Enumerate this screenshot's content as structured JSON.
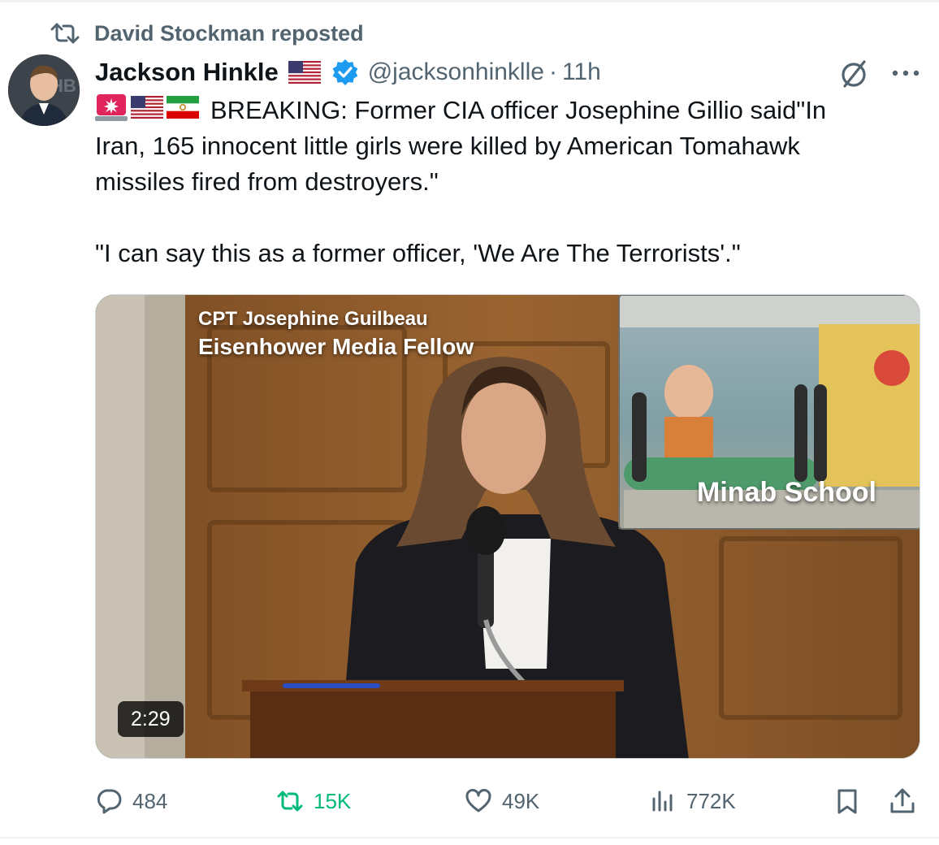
{
  "repost": {
    "text": "David Stockman reposted",
    "icon": "repost-icon"
  },
  "author": {
    "name": "Jackson Hinkle",
    "handle": "@jacksonhinklle",
    "separator": "·",
    "time": "11h",
    "verified": true,
    "flag": "us-flag-icon"
  },
  "tweet": {
    "emojis": [
      "siren-emoji",
      "us-flag-emoji",
      "iran-flag-emoji"
    ],
    "line1": "BREAKING: Former CIA officer Josephine Gillio said\"In",
    "line2": "Iran, 165 innocent little girls were killed by American Tomahawk",
    "line3": "missiles fired from destroyers.\"",
    "line4": "\"I can say this as a former officer, 'We Are The Terrorists'.\""
  },
  "media": {
    "caption_name": "CPT Josephine Guilbeau",
    "caption_title": "Eisenhower Media Fellow",
    "inset_label": "Minab School",
    "duration": "2:29"
  },
  "actions": {
    "reply": "484",
    "repost": "15K",
    "like": "49K",
    "views": "772K"
  },
  "colors": {
    "text_primary": "#0f1419",
    "text_secondary": "#536471",
    "verified_blue": "#1d9bf0",
    "repost_green": "#00ba7c",
    "divider": "#eff3f4"
  }
}
